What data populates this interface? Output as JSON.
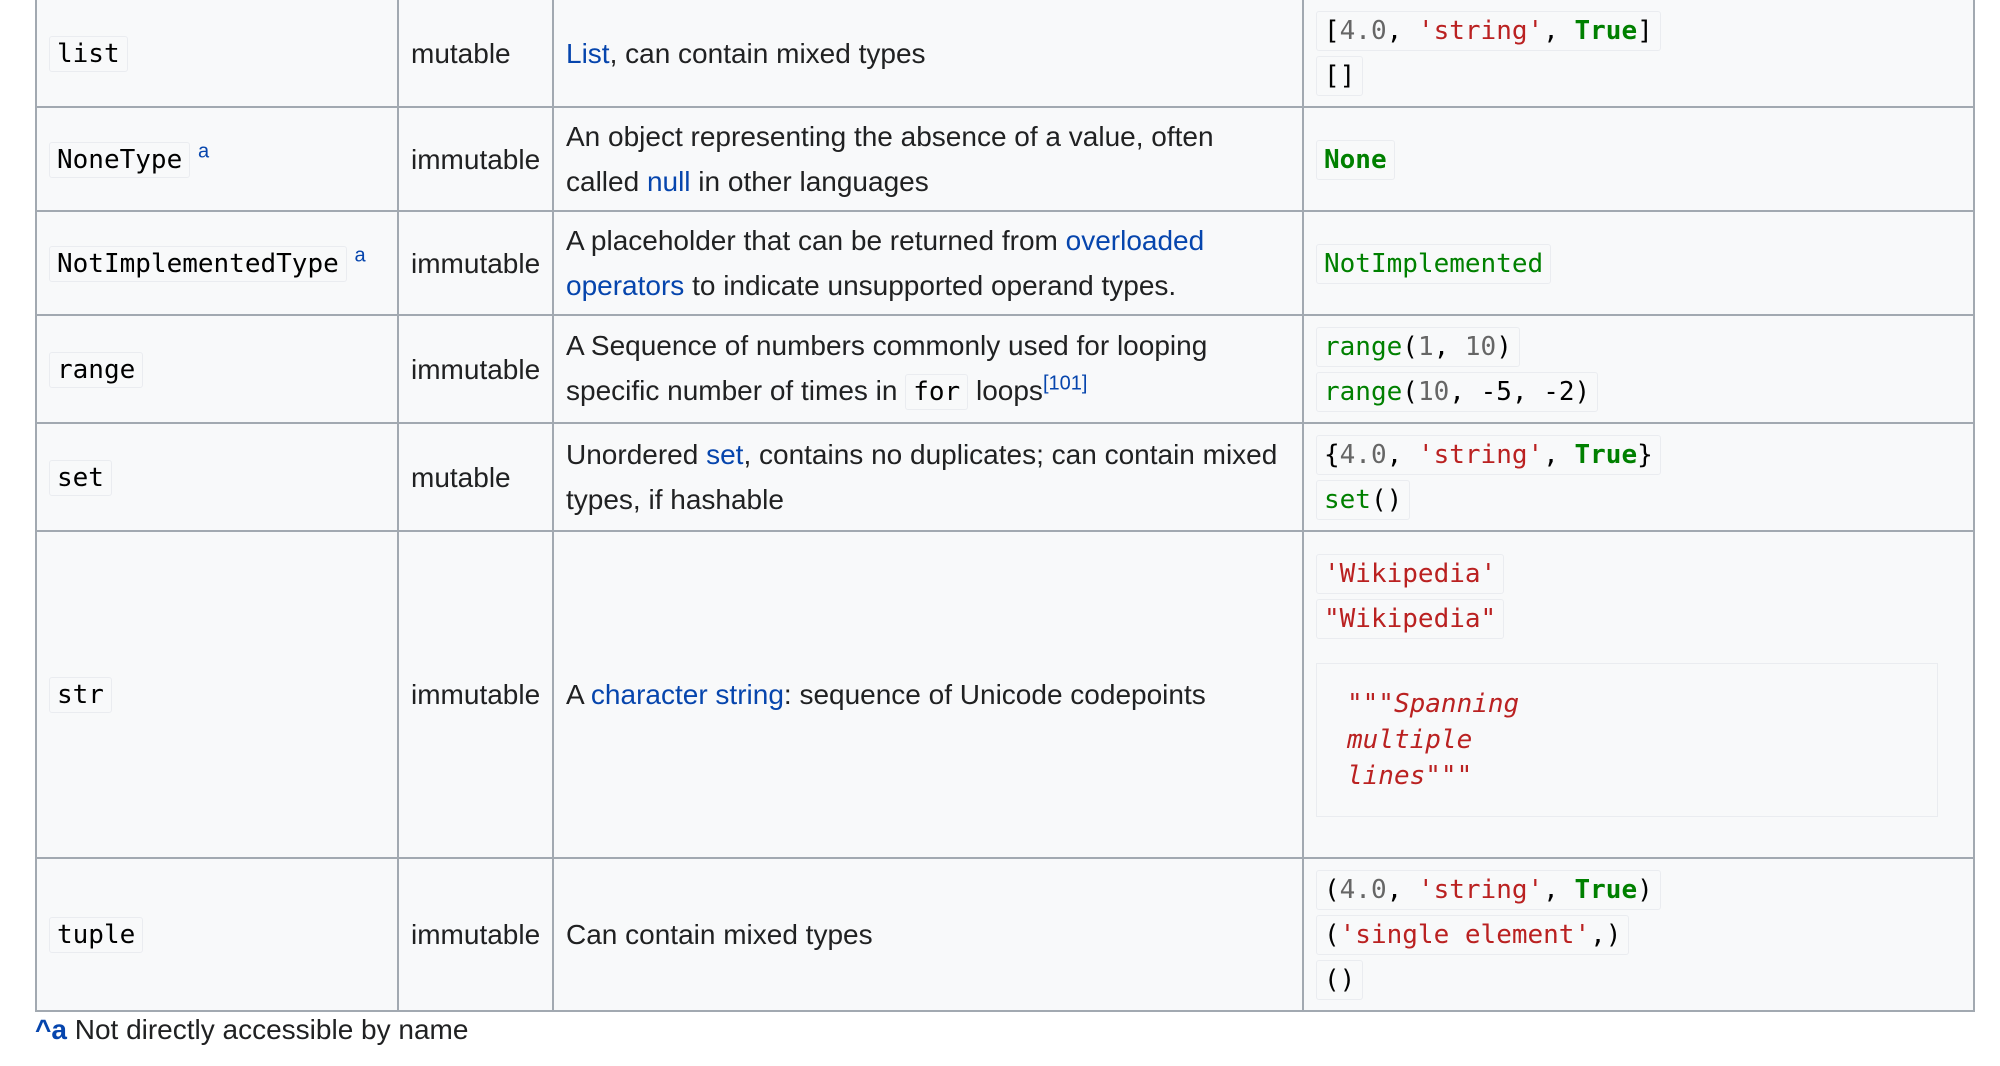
{
  "rows": [
    {
      "type": "list",
      "mutability": "mutable",
      "desc_link": "List",
      "desc_rest": ", can contain mixed types",
      "examples": {
        "ex1": {
          "open": "[",
          "num": "4.0",
          "sep1": ", ",
          "str": "'string'",
          "sep2": ", ",
          "kw": "True",
          "close": "]"
        },
        "ex2": "[]"
      }
    },
    {
      "type": "NoneType",
      "footnote": "a",
      "mutability": "immutable",
      "desc_pre": "An object representing the absence of a value, often called ",
      "desc_link": "null",
      "desc_post": " in other languages",
      "example": "None"
    },
    {
      "type": "NotImplementedType",
      "footnote": "a",
      "mutability": "immutable",
      "desc_pre": "A placeholder that can be returned from ",
      "desc_link": "overloaded operators",
      "desc_post": " to indicate unsupported operand types.",
      "example": "NotImplemented"
    },
    {
      "type": "range",
      "mutability": "immutable",
      "desc_pre": "A Sequence of numbers commonly used for looping specific number of times in ",
      "desc_code": "for",
      "desc_post": " loops",
      "ref": "[101]",
      "examples": {
        "ex1": {
          "fn": "range",
          "open": "(",
          "a": "1",
          "sep": ", ",
          "b": "10",
          "close": ")"
        },
        "ex2": {
          "fn": "range",
          "open": "(",
          "a": "10",
          "sep1": ", ",
          "b": "-5",
          "sep2": ", ",
          "c": "-2",
          "close": ")"
        }
      }
    },
    {
      "type": "set",
      "mutability": "mutable",
      "desc_pre": "Unordered ",
      "desc_link": "set",
      "desc_post": ", contains no duplicates; can contain mixed types, if hashable",
      "examples": {
        "ex1": {
          "open": "{",
          "num": "4.0",
          "sep1": ", ",
          "str": "'string'",
          "sep2": ", ",
          "kw": "True",
          "close": "}"
        },
        "ex2": {
          "fn": "set",
          "parens": "()"
        }
      }
    },
    {
      "type": "str",
      "mutability": "immutable",
      "desc_pre": "A ",
      "desc_link": "character string",
      "desc_post": ": sequence of Unicode codepoints",
      "examples": {
        "ex1": "'Wikipedia'",
        "ex2": "\"Wikipedia\"",
        "ex3": "\"\"\"Spanning\nmultiple\nlines\"\"\""
      }
    },
    {
      "type": "tuple",
      "mutability": "immutable",
      "desc": "Can contain mixed types",
      "examples": {
        "ex1": {
          "open": "(",
          "num": "4.0",
          "sep1": ", ",
          "str": "'string'",
          "sep2": ", ",
          "kw": "True",
          "close": ")"
        },
        "ex2": {
          "open": "(",
          "str": "'single element'",
          "close": ",)"
        },
        "ex3": "()"
      }
    }
  ],
  "footnote": {
    "caret": "^",
    "letter": "a",
    "text": " Not directly accessible by name"
  },
  "colors": {
    "link": "#0645ad",
    "string": "#ba2121",
    "keyword": "#008000",
    "number": "#666666",
    "border": "#a2a9b1",
    "cell_bg": "#f8f9fa"
  }
}
